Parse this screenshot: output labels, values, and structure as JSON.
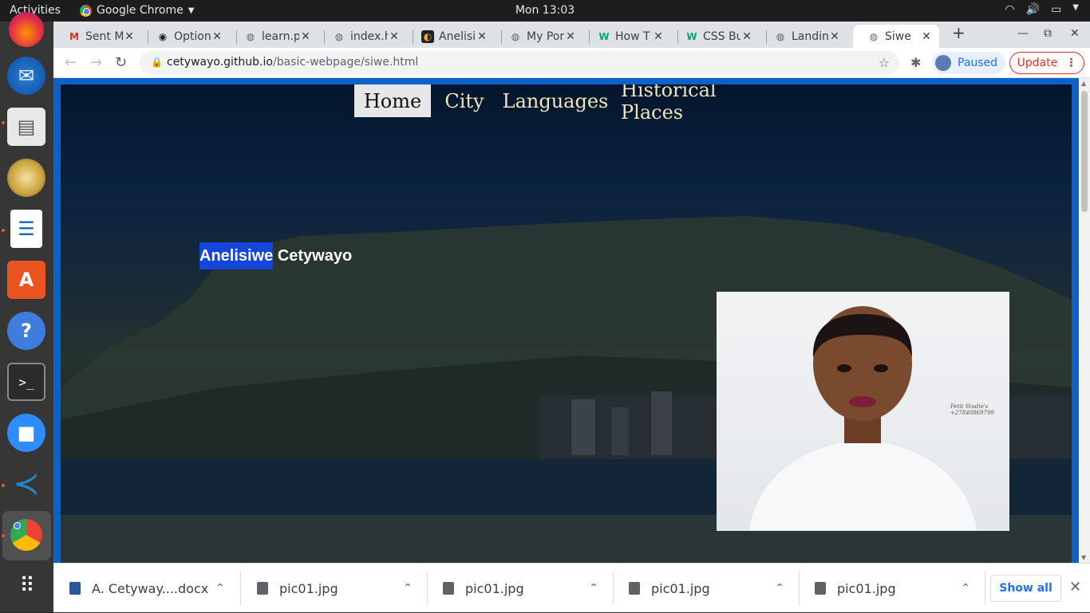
{
  "system": {
    "activities": "Activities",
    "app_name": "Google Chrome",
    "clock": "Mon 13:03"
  },
  "tabs": [
    {
      "title": "Sent M",
      "favicon": "gmail-icon"
    },
    {
      "title": "Option",
      "favicon": "github-icon"
    },
    {
      "title": "learn.p",
      "favicon": "globe-icon"
    },
    {
      "title": "index.h",
      "favicon": "globe-icon"
    },
    {
      "title": "Anelisi",
      "favicon": "app-icon"
    },
    {
      "title": "My Por",
      "favicon": "globe-icon"
    },
    {
      "title": "How T",
      "favicon": "w3schools-icon"
    },
    {
      "title": "CSS Bu",
      "favicon": "w3schools-icon"
    },
    {
      "title": "Landin",
      "favicon": "globe-icon"
    },
    {
      "title": "Siwe",
      "favicon": "globe-icon",
      "active": true
    }
  ],
  "address_bar": {
    "domain": "cetywayo.github.io",
    "path": "/basic-webpage/siwe.html"
  },
  "profile": {
    "paused_label": "Paused",
    "update_label": "Update"
  },
  "page": {
    "nav": [
      {
        "label": "Home",
        "active": true
      },
      {
        "label": "City"
      },
      {
        "label": "Languages"
      },
      {
        "label": "Historical Places"
      }
    ],
    "name_first": "Anelisiwe",
    "name_last": " Cetywayo",
    "photo_watermark_line1": "Petit Studio's",
    "photo_watermark_line2": "+27840869799"
  },
  "downloads": {
    "items": [
      {
        "name": "A. Cetyway....docx",
        "type": "word-doc-icon"
      },
      {
        "name": "pic01.jpg",
        "type": "image-file-icon"
      },
      {
        "name": "pic01.jpg",
        "type": "image-file-icon"
      },
      {
        "name": "pic01.jpg",
        "type": "image-file-icon"
      },
      {
        "name": "pic01.jpg",
        "type": "image-file-icon"
      }
    ],
    "show_all": "Show all"
  },
  "colors": {
    "page_frame": "#0b63c9",
    "nav_text": "#f0e4b8",
    "selection": "#1447d9",
    "update_red": "#d93025",
    "link_blue": "#1a73e8"
  }
}
